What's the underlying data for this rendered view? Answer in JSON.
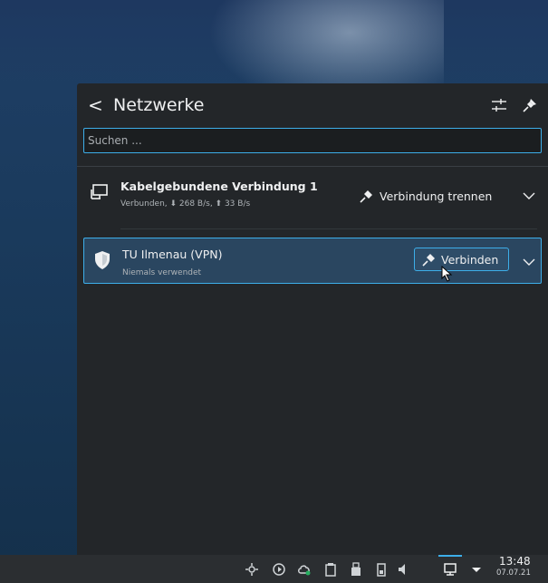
{
  "panel": {
    "back": "<",
    "title": "Netzwerke"
  },
  "search": {
    "placeholder": "Suchen ..."
  },
  "connections": [
    {
      "name": "Kabelgebundene Verbindung 1",
      "status": "Verbunden, ⬇ 268 B/s, ⬆ 33 B/s",
      "action": "Verbindung trennen",
      "icon": "wired-network-icon"
    },
    {
      "name": "TU Ilmenau (VPN)",
      "status": "Niemals verwendet",
      "action": "Verbinden",
      "icon": "vpn-shield-icon"
    }
  ],
  "taskbar": {
    "time": "13:48",
    "date": "07.07.21",
    "tray_icons": [
      "settings-icon",
      "media-play-icon",
      "cloud-sync-icon",
      "clipboard-icon",
      "usb-device-icon",
      "battery-icon",
      "volume-icon",
      "network-icon",
      "tray-expand-icon"
    ]
  },
  "colors": {
    "accent": "#3daee9",
    "panel_bg": "#232629",
    "highlight_bg": "#2a4660"
  }
}
